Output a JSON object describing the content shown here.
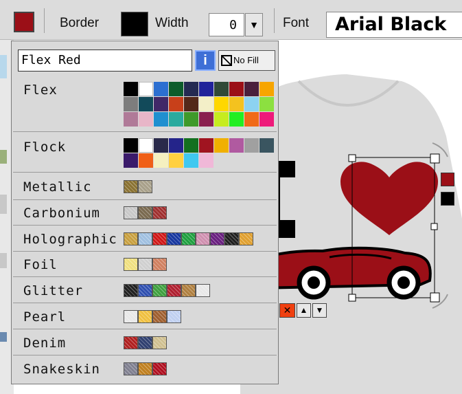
{
  "toolbar": {
    "current_color": "#9b0f17",
    "border_label": "Border",
    "border_color": "#000000",
    "width_label": "Width",
    "width_value": "0",
    "font_label": "Font",
    "font_value": "Arial Black"
  },
  "popup": {
    "color_name": "Flex Red",
    "info_label": "i",
    "nofill_label": "No Fill",
    "flex_label": "Flex",
    "flex_colors": [
      "#000000",
      "#ffffff",
      "#2c6fd1",
      "#0d5c2b",
      "#242a52",
      "#21239a",
      "#314a37",
      "#9b0f17",
      "#4a1f3c",
      "#f7a500",
      "#7d7d7d",
      "#124a5a",
      "#412868",
      "#c8401a",
      "#53281a",
      "#f3efc8",
      "#ffd700",
      "#f4c21f",
      "#8cd2f0",
      "#8ce040",
      "#b07a98",
      "#e8b6c8",
      "#1f8fd0",
      "#2aaa9e",
      "#3f9a2a",
      "#8a1f4f",
      "#c6ec1f",
      "#22ee22",
      "#f06a18",
      "#ee1a7a"
    ],
    "flock_label": "Flock",
    "flock_colors": [
      "#000000",
      "#ffffff",
      "#2a2a4a",
      "#24248a",
      "#147020",
      "#a01420",
      "#f0b000",
      "#b05aa0",
      "#a0a0a0",
      "#3a5560",
      "#3a1a6a",
      "#f06018",
      "#f5f0c0",
      "#ffd040",
      "#40c8f0",
      "#f0b8d8"
    ],
    "metallic_label": "Metallic",
    "metallic_colors": [
      "#8a7232",
      "#a8a08a"
    ],
    "carbonium_label": "Carbonium",
    "carbonium_colors": [
      "#c8c8c8",
      "#7a6a50",
      "#a03030"
    ],
    "holographic_label": "Holographic",
    "holographic_colors": [
      "#c8a040",
      "#a0c0e0",
      "#d01818",
      "#1838a0",
      "#20a040",
      "#d090b0",
      "#6a2080",
      "#202020",
      "#e0a030"
    ],
    "foil_label": "Foil",
    "foil_colors": [
      "#f0e080",
      "#d0d0d0",
      "#d08060"
    ],
    "glitter_label": "Glitter",
    "glitter_colors": [
      "#202020",
      "#3050b0",
      "#40a040",
      "#b02030",
      "#b08040",
      "#e8e8e8"
    ],
    "pearl_label": "Pearl",
    "pearl_colors": [
      "#e8e8e8",
      "#f0c040",
      "#a06030",
      "#c0d0f0"
    ],
    "denim_label": "Denim",
    "denim_colors": [
      "#b02020",
      "#304070",
      "#d0c090"
    ],
    "snakeskin_label": "Snakeskin",
    "snakeskin_colors": [
      "#808090",
      "#c08020",
      "#b01020"
    ]
  },
  "canvas": {
    "heart_color": "#9b0f17",
    "car_color": "#9b0f17",
    "shirt_color": "#dcdcdc",
    "side_swatch_1": "#9b0f17",
    "side_swatch_2": "#000000",
    "delete_label": "✕",
    "up_label": "▲",
    "down_label": "▼"
  }
}
